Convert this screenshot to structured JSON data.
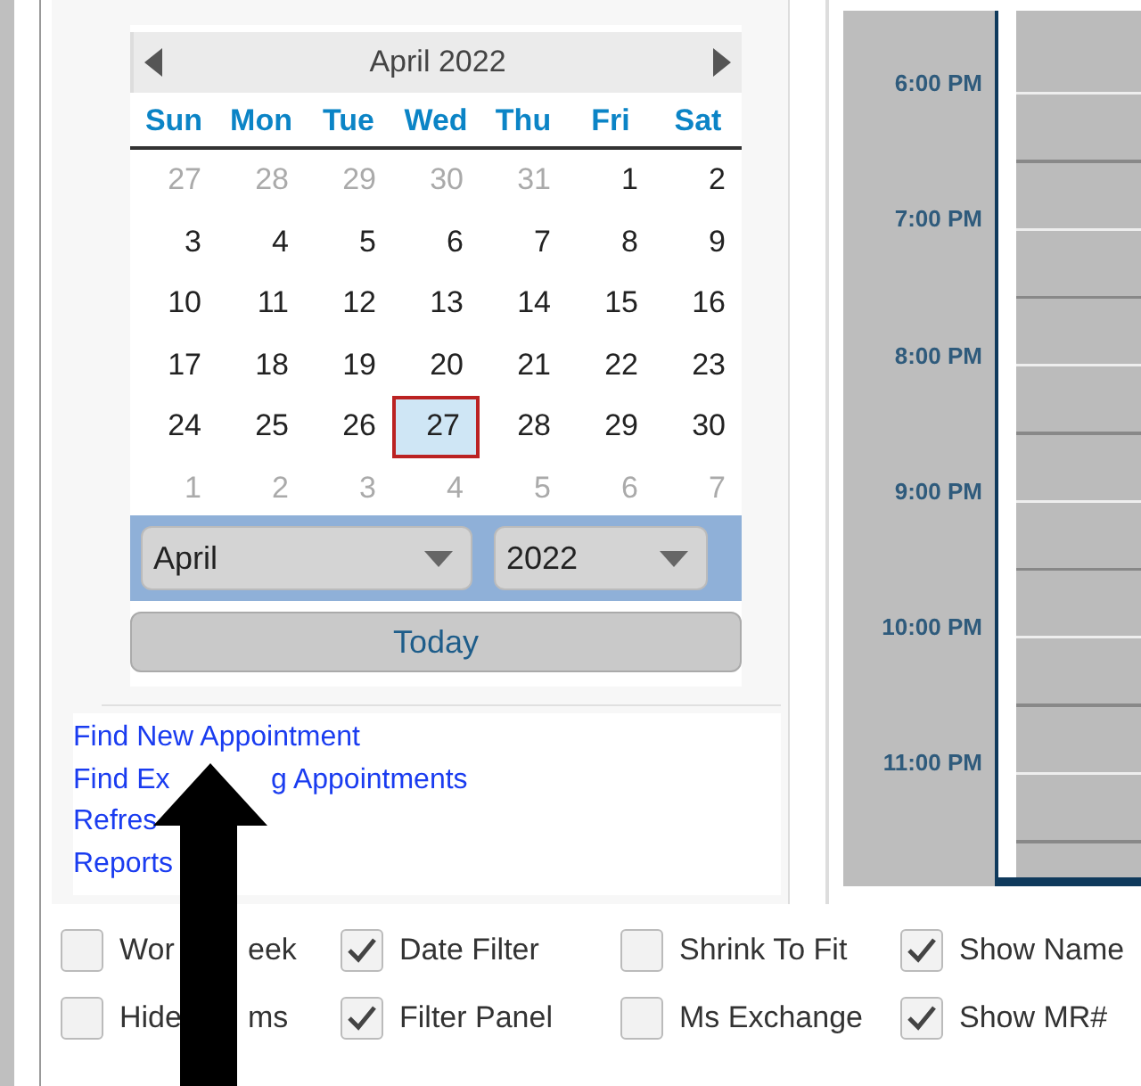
{
  "calendar": {
    "title": "April 2022",
    "weekdays": [
      "Sun",
      "Mon",
      "Tue",
      "Wed",
      "Thu",
      "Fri",
      "Sat"
    ],
    "days": [
      {
        "label": "27",
        "muted": true,
        "selected": false
      },
      {
        "label": "28",
        "muted": true,
        "selected": false
      },
      {
        "label": "29",
        "muted": true,
        "selected": false
      },
      {
        "label": "30",
        "muted": true,
        "selected": false
      },
      {
        "label": "31",
        "muted": true,
        "selected": false
      },
      {
        "label": "1",
        "muted": false,
        "selected": false
      },
      {
        "label": "2",
        "muted": false,
        "selected": false
      },
      {
        "label": "3",
        "muted": false,
        "selected": false
      },
      {
        "label": "4",
        "muted": false,
        "selected": false
      },
      {
        "label": "5",
        "muted": false,
        "selected": false
      },
      {
        "label": "6",
        "muted": false,
        "selected": false
      },
      {
        "label": "7",
        "muted": false,
        "selected": false
      },
      {
        "label": "8",
        "muted": false,
        "selected": false
      },
      {
        "label": "9",
        "muted": false,
        "selected": false
      },
      {
        "label": "10",
        "muted": false,
        "selected": false
      },
      {
        "label": "11",
        "muted": false,
        "selected": false
      },
      {
        "label": "12",
        "muted": false,
        "selected": false
      },
      {
        "label": "13",
        "muted": false,
        "selected": false
      },
      {
        "label": "14",
        "muted": false,
        "selected": false
      },
      {
        "label": "15",
        "muted": false,
        "selected": false
      },
      {
        "label": "16",
        "muted": false,
        "selected": false
      },
      {
        "label": "17",
        "muted": false,
        "selected": false
      },
      {
        "label": "18",
        "muted": false,
        "selected": false
      },
      {
        "label": "19",
        "muted": false,
        "selected": false
      },
      {
        "label": "20",
        "muted": false,
        "selected": false
      },
      {
        "label": "21",
        "muted": false,
        "selected": false
      },
      {
        "label": "22",
        "muted": false,
        "selected": false
      },
      {
        "label": "23",
        "muted": false,
        "selected": false
      },
      {
        "label": "24",
        "muted": false,
        "selected": false
      },
      {
        "label": "25",
        "muted": false,
        "selected": false
      },
      {
        "label": "26",
        "muted": false,
        "selected": false
      },
      {
        "label": "27",
        "muted": false,
        "selected": true
      },
      {
        "label": "28",
        "muted": false,
        "selected": false
      },
      {
        "label": "29",
        "muted": false,
        "selected": false
      },
      {
        "label": "30",
        "muted": false,
        "selected": false
      },
      {
        "label": "1",
        "muted": true,
        "selected": false
      },
      {
        "label": "2",
        "muted": true,
        "selected": false
      },
      {
        "label": "3",
        "muted": true,
        "selected": false
      },
      {
        "label": "4",
        "muted": true,
        "selected": false
      },
      {
        "label": "5",
        "muted": true,
        "selected": false
      },
      {
        "label": "6",
        "muted": true,
        "selected": false
      },
      {
        "label": "7",
        "muted": true,
        "selected": false
      }
    ],
    "month_select": {
      "value": "April"
    },
    "year_select": {
      "value": "2022"
    },
    "today_button": "Today"
  },
  "links": [
    {
      "label_parts": [
        "Find New Appointment"
      ]
    },
    {
      "label_parts": [
        "Find Ex",
        "g Appointments"
      ]
    },
    {
      "label_parts": [
        "Refres"
      ]
    },
    {
      "label_parts": [
        "Reports"
      ]
    }
  ],
  "times": [
    "6:00 PM",
    "7:00 PM",
    "8:00 PM",
    "9:00 PM",
    "10:00 PM",
    "11:00 PM"
  ],
  "options": [
    {
      "label_parts": [
        "Wor",
        "eek"
      ],
      "checked": false
    },
    {
      "label_parts": [
        "Date Filter"
      ],
      "checked": true
    },
    {
      "label_parts": [
        "Shrink To Fit"
      ],
      "checked": false
    },
    {
      "label_parts": [
        "Show Name"
      ],
      "checked": true
    },
    {
      "label_parts": [
        "Hide",
        "ms"
      ],
      "checked": false
    },
    {
      "label_parts": [
        "Filter Panel"
      ],
      "checked": true
    },
    {
      "label_parts": [
        "Ms Exchange"
      ],
      "checked": false
    },
    {
      "label_parts": [
        "Show MR#"
      ],
      "checked": true
    }
  ]
}
